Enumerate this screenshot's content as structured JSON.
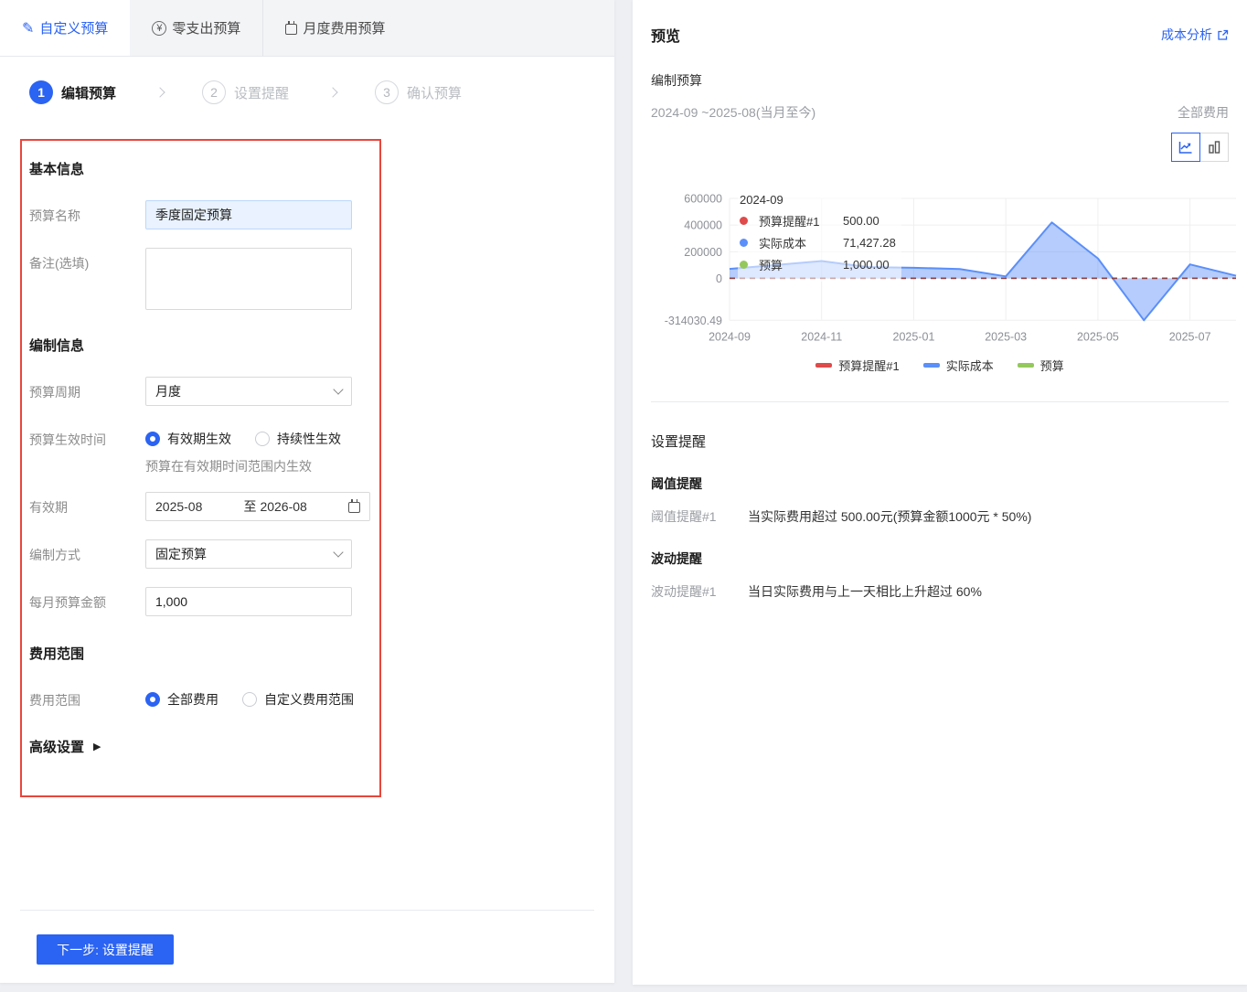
{
  "colors": {
    "primary": "#2b63f2",
    "highlight_border": "#e8453c"
  },
  "icons": {
    "pencil": "✎",
    "yen": "¥",
    "triangle": "▶"
  },
  "tabs": [
    {
      "label": "自定义预算",
      "active": true
    },
    {
      "label": "零支出预算",
      "active": false
    },
    {
      "label": "月度费用预算",
      "active": false
    }
  ],
  "steps": [
    {
      "num": "1",
      "label": "编辑预算",
      "active": true
    },
    {
      "num": "2",
      "label": "设置提醒",
      "active": false
    },
    {
      "num": "3",
      "label": "确认预算",
      "active": false
    }
  ],
  "form": {
    "basic_title": "基本信息",
    "name_label": "预算名称",
    "name_value": "季度固定预算",
    "note_label": "备注(选填)",
    "compile_title": "编制信息",
    "period_label": "预算周期",
    "period_value": "月度",
    "effective_label": "预算生效时间",
    "radio_validity": "有效期生效",
    "radio_continuous": "持续性生效",
    "effective_hint": "预算在有效期时间范围内生效",
    "validity_label": "有效期",
    "validity_start": "2025-08",
    "validity_to": "至",
    "validity_end": "2026-08",
    "method_label": "编制方式",
    "method_value": "固定预算",
    "amount_label": "每月预算金额",
    "amount_value": "1,000",
    "scope_title": "费用范围",
    "scope_label": "费用范围",
    "radio_all": "全部费用",
    "radio_custom": "自定义费用范围",
    "advanced_title": "高级设置",
    "next_button": "下一步: 设置提醒"
  },
  "preview": {
    "title": "预览",
    "link": "成本分析",
    "subtitle": "编制预算",
    "date_range": "2024-09 ~2025-08(当月至今)",
    "scope": "全部费用",
    "alerts": {
      "title": "设置提醒",
      "threshold_title": "阈值提醒",
      "threshold_label": "阈值提醒#1",
      "threshold_text": "当实际费用超过 500.00元(预算金额1000元 * 50%)",
      "fluct_title": "波动提醒",
      "fluct_label": "波动提醒#1",
      "fluct_text": "当日实际费用与上一天相比上升超过 60%"
    }
  },
  "chart_data": {
    "type": "area",
    "x": [
      "2024-09",
      "2024-10",
      "2024-11",
      "2024-12",
      "2025-01",
      "2025-02",
      "2025-03",
      "2025-04",
      "2025-05",
      "2025-06",
      "2025-07",
      "2025-08"
    ],
    "series": [
      {
        "name": "预算提醒#1",
        "color": "#df4a4a",
        "style": "dashed-flat",
        "values": [
          500,
          500,
          500,
          500,
          500,
          500,
          500,
          500,
          500,
          500,
          500,
          500
        ]
      },
      {
        "name": "实际成本",
        "color": "#5b8ff9",
        "style": "area",
        "values": [
          71427.28,
          100000,
          130000,
          85000,
          80000,
          70000,
          15000,
          420000,
          150000,
          -314030.49,
          105000,
          20000
        ]
      },
      {
        "name": "预算",
        "color": "#95c85c",
        "style": "dashed-flat",
        "values": [
          1000,
          1000,
          1000,
          1000,
          1000,
          1000,
          1000,
          1000,
          1000,
          1000,
          1000,
          1000
        ]
      }
    ],
    "yticks": [
      600000,
      400000,
      200000,
      0
    ],
    "ymin_label": "-314030.49",
    "xticks": [
      "2024-09",
      "2024-11",
      "2025-01",
      "2025-03",
      "2025-05",
      "2025-07"
    ],
    "ylim": [
      -314030.49,
      600000
    ],
    "grid": true,
    "legend_position": "bottom",
    "dashed_line_color": "#8b4242",
    "tooltip": {
      "title": "2024-09",
      "rows": [
        {
          "name": "预算提醒#1",
          "value": "500.00",
          "color": "#df4a4a"
        },
        {
          "name": "实际成本",
          "value": "71,427.28",
          "color": "#5b8ff9"
        },
        {
          "name": "预算",
          "value": "1,000.00",
          "color": "#95c85c"
        }
      ]
    }
  }
}
